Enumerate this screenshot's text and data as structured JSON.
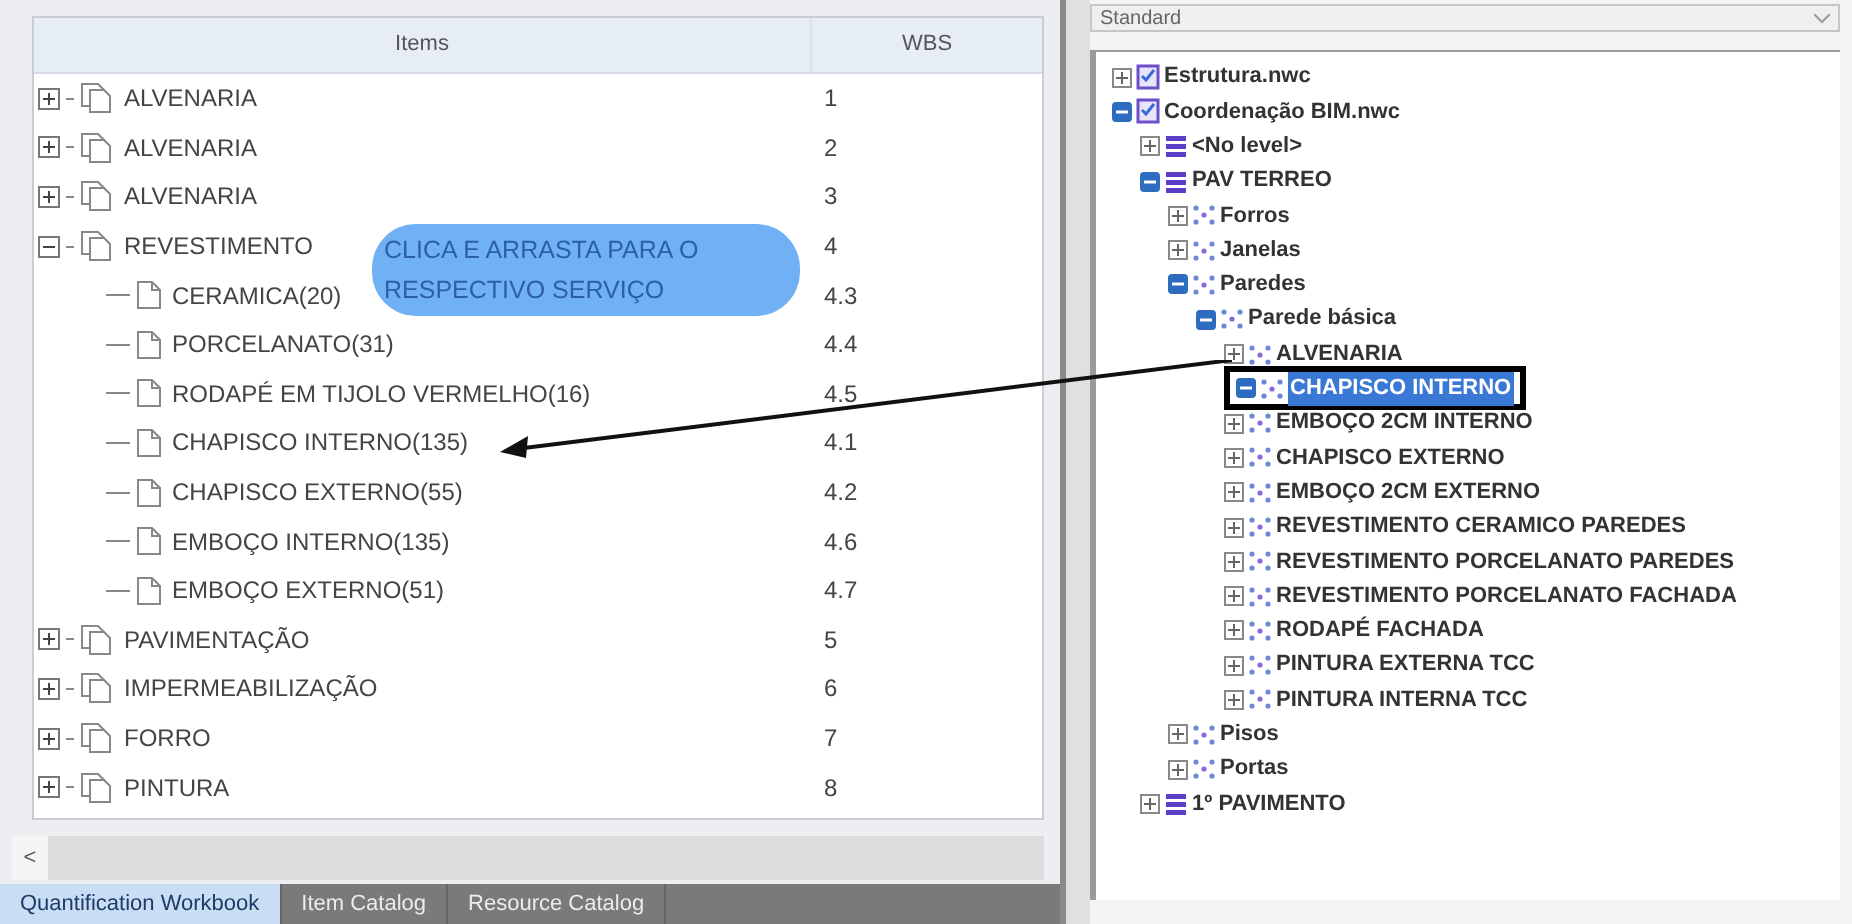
{
  "workbook": {
    "columns": [
      "Items",
      "WBS"
    ],
    "rows": [
      {
        "label": "ALVENARIA",
        "wbs": "1",
        "expanded": false
      },
      {
        "label": "ALVENARIA",
        "wbs": "2",
        "expanded": false
      },
      {
        "label": "ALVENARIA",
        "wbs": "3",
        "expanded": false
      },
      {
        "label": "REVESTIMENTO",
        "wbs": "4",
        "expanded": true,
        "children": [
          {
            "label": "CERAMICA(20)",
            "wbs": "4.3"
          },
          {
            "label": "PORCELANATO(31)",
            "wbs": "4.4"
          },
          {
            "label": "RODAPÉ EM TIJOLO VERMELHO(16)",
            "wbs": "4.5"
          },
          {
            "label": "CHAPISCO INTERNO(135)",
            "wbs": "4.1"
          },
          {
            "label": "CHAPISCO EXTERNO(55)",
            "wbs": "4.2"
          },
          {
            "label": "EMBOÇO INTERNO(135)",
            "wbs": "4.6"
          },
          {
            "label": "EMBOÇO EXTERNO(51)",
            "wbs": "4.7"
          }
        ]
      },
      {
        "label": "PAVIMENTAÇÃO",
        "wbs": "5",
        "expanded": false
      },
      {
        "label": "IMPERMEABILIZAÇÃO",
        "wbs": "6",
        "expanded": false
      },
      {
        "label": "FORRO",
        "wbs": "7",
        "expanded": false
      },
      {
        "label": "PINTURA",
        "wbs": "8",
        "expanded": false
      }
    ]
  },
  "scroll_left": "<",
  "tabs": [
    {
      "label": "Quantification Workbook",
      "selected": true
    },
    {
      "label": "Item Catalog",
      "selected": false
    },
    {
      "label": "Resource Catalog",
      "selected": false
    }
  ],
  "annotation": {
    "text": "CLICA E ARRASTA PARA O RESPECTIVO SERVIÇO"
  },
  "model_tree": {
    "dropdown": "Standard",
    "nodes": [
      {
        "label": "Estrutura.nwc",
        "kind": "file",
        "expanded": false,
        "selected": false
      },
      {
        "label": "Coordenação BIM.nwc",
        "kind": "file",
        "expanded": true,
        "selected": false,
        "children": [
          {
            "label": "<No level>",
            "kind": "level",
            "expanded": false,
            "selected": false
          },
          {
            "label": "PAV TERREO",
            "kind": "level",
            "expanded": true,
            "selected": false,
            "children": [
              {
                "label": "Forros",
                "kind": "category",
                "expanded": false,
                "selected": false
              },
              {
                "label": "Janelas",
                "kind": "category",
                "expanded": false,
                "selected": false
              },
              {
                "label": "Paredes",
                "kind": "category",
                "expanded": true,
                "selected": false,
                "children": [
                  {
                    "label": "Parede básica",
                    "kind": "category",
                    "expanded": true,
                    "selected": false,
                    "children": [
                      {
                        "label": "ALVENARIA",
                        "kind": "category",
                        "expanded": false,
                        "selected": false
                      },
                      {
                        "label": "CHAPISCO INTERNO",
                        "kind": "category",
                        "expanded": true,
                        "selected": true
                      },
                      {
                        "label": "EMBOÇO 2CM INTERNO",
                        "kind": "category",
                        "expanded": false,
                        "selected": false
                      },
                      {
                        "label": "CHAPISCO EXTERNO",
                        "kind": "category",
                        "expanded": false,
                        "selected": false
                      },
                      {
                        "label": "EMBOÇO 2CM EXTERNO",
                        "kind": "category",
                        "expanded": false,
                        "selected": false
                      },
                      {
                        "label": "REVESTIMENTO CERAMICO PAREDES",
                        "kind": "category",
                        "expanded": false,
                        "selected": false
                      },
                      {
                        "label": "REVESTIMENTO PORCELANATO PAREDES",
                        "kind": "category",
                        "expanded": false,
                        "selected": false
                      },
                      {
                        "label": "REVESTIMENTO PORCELANATO FACHADA",
                        "kind": "category",
                        "expanded": false,
                        "selected": false
                      },
                      {
                        "label": "RODAPÉ FACHADA",
                        "kind": "category",
                        "expanded": false,
                        "selected": false
                      },
                      {
                        "label": "PINTURA EXTERNA TCC",
                        "kind": "category",
                        "expanded": false,
                        "selected": false
                      },
                      {
                        "label": "PINTURA INTERNA TCC",
                        "kind": "category",
                        "expanded": false,
                        "selected": false
                      }
                    ]
                  }
                ]
              },
              {
                "label": "Pisos",
                "kind": "category",
                "expanded": false,
                "selected": false
              },
              {
                "label": "Portas",
                "kind": "category",
                "expanded": false,
                "selected": false
              }
            ]
          },
          {
            "label": "1º PAVIMENTO",
            "kind": "level",
            "expanded": false,
            "selected": false
          }
        ]
      }
    ]
  }
}
